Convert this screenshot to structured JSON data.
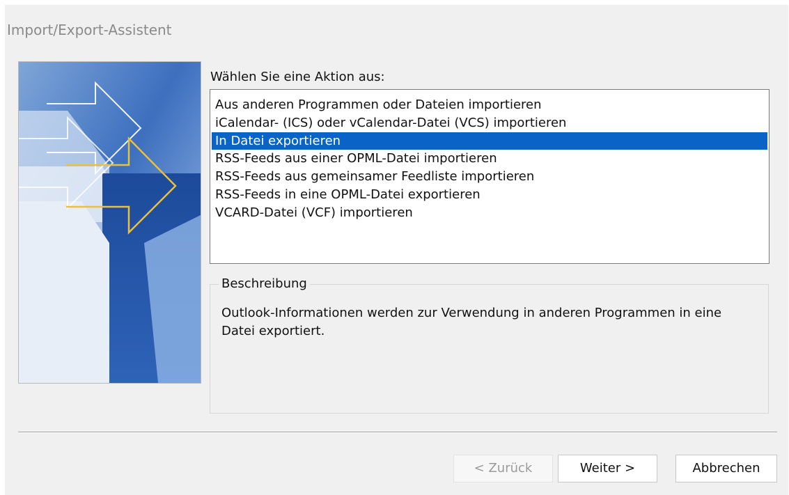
{
  "window": {
    "title": "Import/Export-Assistent"
  },
  "main": {
    "prompt": "Wählen Sie eine Aktion aus:",
    "actions": [
      "Aus anderen Programmen oder Dateien importieren",
      "iCalendar- (ICS) oder vCalendar-Datei (VCS) importieren",
      "In Datei exportieren",
      "RSS-Feeds aus einer OPML-Datei importieren",
      "RSS-Feeds aus gemeinsamer Feedliste importieren",
      "RSS-Feeds in eine OPML-Datei exportieren",
      "VCARD-Datei (VCF) importieren"
    ],
    "selected_action": "In Datei exportieren",
    "description_label": "Beschreibung",
    "description_text": "Outlook-Informationen werden zur Verwendung in anderen Programmen in eine Datei exportiert."
  },
  "buttons": {
    "back": "< Zurück",
    "next": "Weiter >",
    "cancel": "Abbrechen"
  },
  "colors": {
    "selection": "#0a64c8",
    "dialog_background": "#f0f0f0",
    "graphic_blue": "#2a5aa8",
    "graphic_arrow_outline": "#e8c23a"
  },
  "icons": {
    "wizard_graphic": "import-export-arrows-graphic"
  }
}
